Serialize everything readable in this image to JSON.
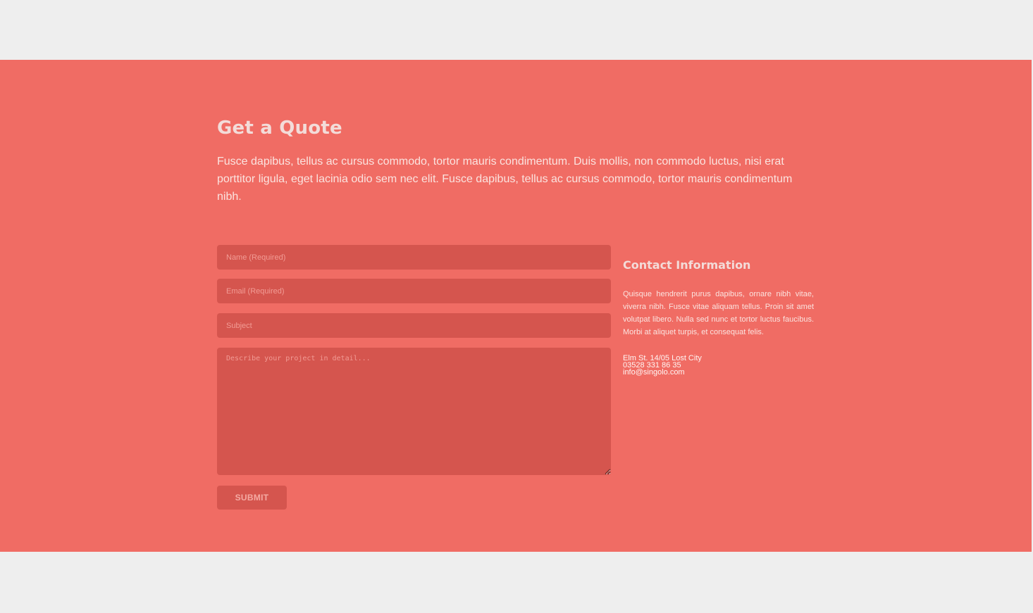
{
  "quote": {
    "title": "Get a Quote",
    "intro": "Fusce dapibus, tellus ac cursus commodo, tortor mauris condimentum. Duis mollis, non commodo luctus, nisi erat porttitor ligula, eget lacinia odio sem nec elit. Fusce dapibus, tellus ac cursus commodo, tortor mauris condimentum nibh."
  },
  "form": {
    "name_placeholder": "Name (Required)",
    "email_placeholder": "Email (Required)",
    "subject_placeholder": "Subject",
    "message_placeholder": "Describe your project in detail...",
    "submit_label": "SUBMIT"
  },
  "contact": {
    "title": "Contact Information",
    "text": "Quisque hendrerit purus dapibus, ornare nibh vitae, viverra nibh. Fusce vitae aliquam tellus. Proin sit amet volutpat libero. Nulla sed nunc et tortor luctus faucibus. Morbi at aliquet turpis, et consequat felis.",
    "address": "Elm St. 14/05 Lost City",
    "phone": "03528 331 86 35",
    "email": "info@singolo.com"
  },
  "colors": {
    "page_background": "#eeeeee",
    "section_background": "#f06c64",
    "field_background": "#d5554e"
  }
}
